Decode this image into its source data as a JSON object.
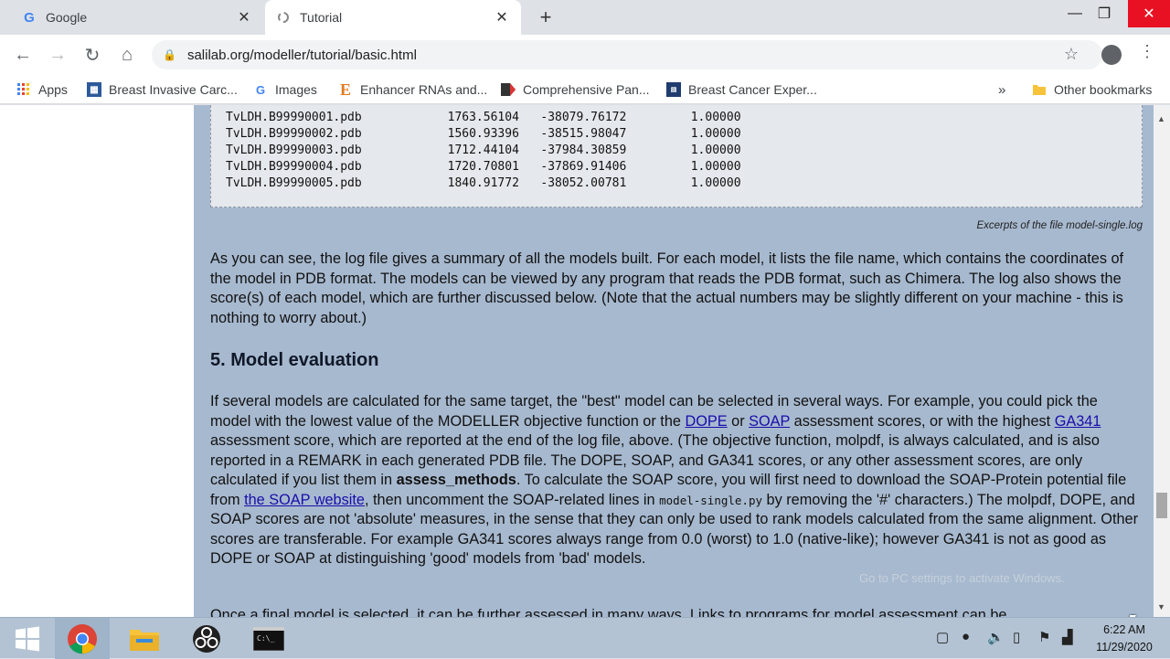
{
  "tabs": [
    {
      "title": "Google",
      "favicon": "G",
      "close": "✕"
    },
    {
      "title": "Tutorial",
      "favicon": "spinner-icon",
      "close": "✕"
    }
  ],
  "new_tab": "+",
  "window_controls": {
    "minimize": "—",
    "maximize": "❐",
    "close": "✕"
  },
  "address": {
    "url": "salilab.org/modeller/tutorial/basic.html"
  },
  "bookmarks": {
    "items": [
      {
        "label": "Apps",
        "icon": "apps-grid-icon"
      },
      {
        "label": "Breast Invasive Carc...",
        "icon": "cbioportal-icon"
      },
      {
        "label": "Images",
        "icon": "google-icon",
        "glyph": "G"
      },
      {
        "label": "Enhancer RNAs and...",
        "icon": "elsevier-icon",
        "glyph": "E"
      },
      {
        "label": "Comprehensive Pan...",
        "icon": "cell-icon"
      },
      {
        "label": "Breast Cancer Exper...",
        "icon": "journal-icon"
      }
    ],
    "overflow": "»",
    "other": "Other bookmarks"
  },
  "log_rows": [
    "TvLDH.B99990001.pdb            1763.56104   -38079.76172         1.00000",
    "TvLDH.B99990002.pdb            1560.93396   -38515.98047         1.00000",
    "TvLDH.B99990003.pdb            1712.44104   -37984.30859         1.00000",
    "TvLDH.B99990004.pdb            1720.70801   -37869.91406         1.00000",
    "TvLDH.B99990005.pdb            1840.91772   -38052.00781         1.00000"
  ],
  "caption": "Excerpts of the file model-single.log",
  "para1": "As you can see, the log file gives a summary of all the models built. For each model, it lists the file name, which contains the coordinates of the model in PDB format. The models can be viewed by any program that reads the PDB format, such as Chimera. The log also shows the score(s) of each model, which are further discussed below. (Note that the actual numbers may be slightly different on your machine - this is nothing to worry about.)",
  "section_title": "5. Model evaluation",
  "para2": {
    "t1": "If several models are calculated for the same target, the \"best\" model can be selected in several ways. For example, you could pick the model with the lowest value of the MODELLER objective function or the ",
    "link_dope": "DOPE",
    "t2": " or ",
    "link_soap": "SOAP",
    "t3": " assessment scores, or with the highest ",
    "link_ga341": "GA341",
    "t4": " assessment score, which are reported at the end of the log file, above. (The objective function, molpdf, is always calculated, and is also reported in a REMARK in each generated PDB file. The DOPE, SOAP, and GA341 scores, or any other assessment scores, are only calculated if you list them in ",
    "bold": "assess_methods",
    "t5": ". To calculate the SOAP score, you will first need to download the SOAP-Protein potential file from ",
    "link_soap_site": "the SOAP website",
    "t6": ", then uncomment the SOAP-related lines in ",
    "code": "model-single.py",
    "t7": " by removing the '#' characters.) The molpdf, DOPE, and SOAP scores are not 'absolute' measures, in the sense that they can only be used to rank models calculated from the same alignment. Other scores are transferable. For example GA341 scores always range from 0.0 (worst) to 1.0 (native-like); however GA341 is not as good as DOPE or SOAP at distinguishing 'good' models from 'bad' models."
  },
  "para3": "Once a final model is selected, it can be further assessed in many ways. Links to programs for model assessment can be",
  "watermark": "Go to PC settings to activate Windows.",
  "clock": {
    "time": "6:22 AM",
    "date": "11/29/2020"
  }
}
